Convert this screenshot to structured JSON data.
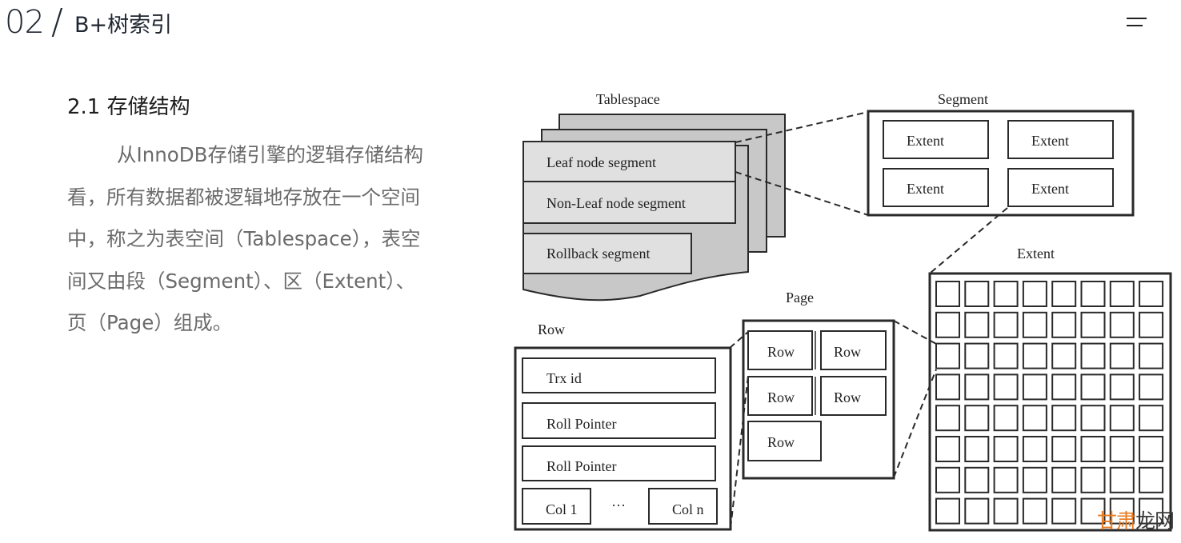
{
  "header": {
    "section_number": "02",
    "separator": "/",
    "title": "B+树索引",
    "menu_icon": "hamburger-menu-icon"
  },
  "section": {
    "title": "2.1 存储结构",
    "paragraph_lines": [
      "从InnoDB存储引擎的逻辑存储结构",
      "看，所有数据都被逻辑地存放在一个空间",
      "中，称之为表空间（Tablespace），表空",
      "间又由段（Segment）、区（Extent）、",
      "页（Page）组成。"
    ]
  },
  "diagram": {
    "tablespace": {
      "title": "Tablespace",
      "segments": [
        "Leaf node segment",
        "Non-Leaf node segment",
        "Rollback segment"
      ]
    },
    "segment": {
      "title": "Segment",
      "extents": [
        "Extent",
        "Extent",
        "Extent",
        "Extent"
      ]
    },
    "extent": {
      "title": "Extent",
      "grid_rows": 8,
      "grid_cols": 8
    },
    "page": {
      "title": "Page",
      "rows": [
        "Row",
        "Row",
        "Row",
        "Row",
        "Row"
      ]
    },
    "row": {
      "title": "Row",
      "fields": [
        "Trx id",
        "Roll Pointer",
        "Roll Pointer"
      ],
      "col_first": "Col 1",
      "col_ellipsis": "···",
      "col_last": "Col n"
    },
    "colors": {
      "stroke": "#2a2a2a",
      "layer_fill": "#c8c8c8",
      "segment_fill": "#e0e0e0"
    }
  },
  "watermark": {
    "part_a": "甘肃",
    "part_b": "龙网"
  }
}
